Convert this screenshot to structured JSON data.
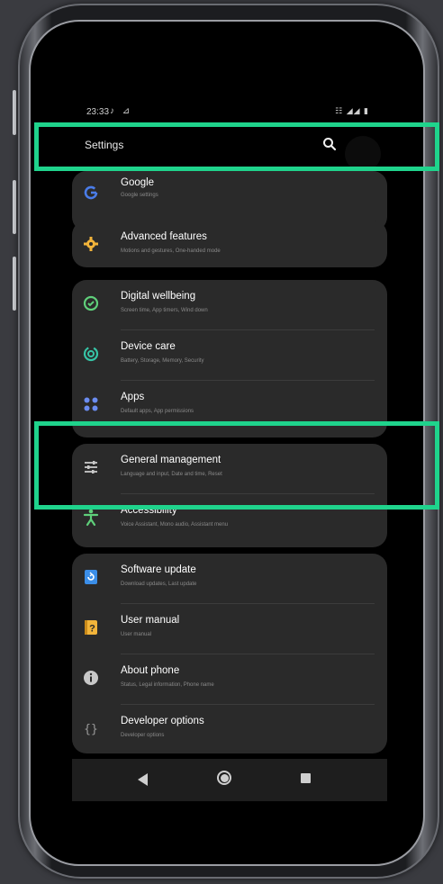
{
  "status_bar": {
    "time": "23:33",
    "left_icons": "♪ ⊿",
    "right_icons": "☷ ◢◢ ▮"
  },
  "app_bar": {
    "title": "Settings",
    "search_icon": "search-icon"
  },
  "settings": {
    "google": {
      "title": "Google",
      "subtitle": "Google settings",
      "icon": "google-icon",
      "color": "#4a7ce8"
    },
    "advanced": {
      "title": "Advanced features",
      "subtitle": "Motions and gestures, One-handed mode",
      "icon": "gear-icon",
      "color": "#f2b43a"
    },
    "wellbeing": {
      "title": "Digital wellbeing",
      "subtitle": "Screen time, App timers, Wind down",
      "icon": "wellbeing-icon",
      "color": "#5fcf7a"
    },
    "device_care": {
      "title": "Device care",
      "subtitle": "Battery, Storage, Memory, Security",
      "icon": "device-care-icon",
      "color": "#36c4a6"
    },
    "apps": {
      "title": "Apps",
      "subtitle": "Default apps, App permissions",
      "icon": "apps-icon",
      "color": "#6b8cf0"
    },
    "general": {
      "title": "General management",
      "subtitle": "Language and input, Date and time, Reset",
      "icon": "sliders-icon",
      "color": "#c8c8c8"
    },
    "accessibility": {
      "title": "Accessibility",
      "subtitle": "Voice Assistant, Mono audio, Assistant menu",
      "icon": "accessibility-icon",
      "color": "#5fcf7a"
    },
    "software_update": {
      "title": "Software update",
      "subtitle": "Download updates, Last update",
      "icon": "software-update-icon",
      "color": "#3b8ee8"
    },
    "user_manual": {
      "title": "User manual",
      "subtitle": "User manual",
      "icon": "user-manual-icon",
      "color": "#f2b43a"
    },
    "about_phone": {
      "title": "About phone",
      "subtitle": "Status, Legal information, Phone name",
      "icon": "info-icon",
      "color": "#c8c8c8"
    },
    "developer": {
      "title": "Developer options",
      "subtitle": "Developer options",
      "icon": "developer-icon",
      "color": "#9a9a9a"
    }
  },
  "highlight_color": "#1fd38c"
}
